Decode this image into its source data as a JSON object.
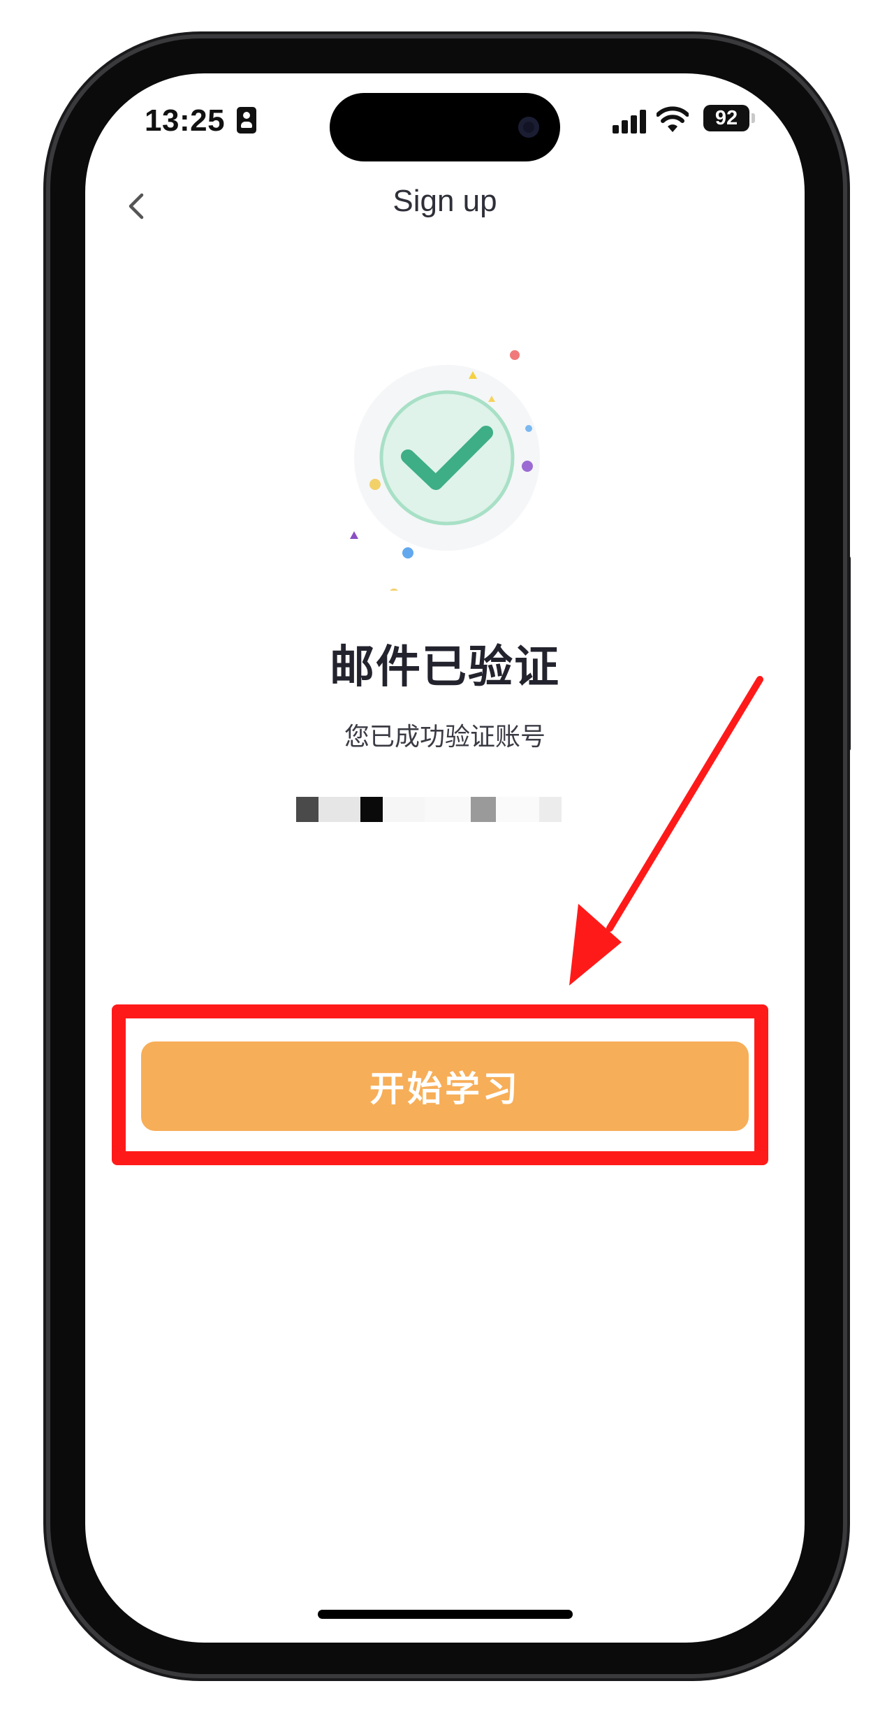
{
  "status_bar": {
    "time": "13:25",
    "battery_level": "92",
    "signal_bars": 4,
    "icons": [
      "contact-card-icon",
      "cellular-signal-icon",
      "wifi-icon",
      "battery-icon"
    ]
  },
  "nav": {
    "title": "Sign up",
    "back_icon": "chevron-left-icon"
  },
  "illustration": {
    "icon": "checkmark-icon",
    "colors": {
      "circle_fill": "#dff3ea",
      "circle_stroke": "#a8e0c6",
      "check": "#3dae86",
      "halo": "#f5f6f8",
      "confetti": [
        "#f07a7a",
        "#f4d142",
        "#f5d45e",
        "#7ab8ef",
        "#9b6bd3",
        "#8a4fc3",
        "#62a8ee",
        "#f2d169"
      ]
    }
  },
  "content": {
    "headline": "邮件已验证",
    "subtext": "您已成功验证账号",
    "email_redacted": true
  },
  "cta": {
    "label": "开始学习",
    "color": "#f7ae58"
  },
  "annotation": {
    "color": "#ff1a1a"
  }
}
